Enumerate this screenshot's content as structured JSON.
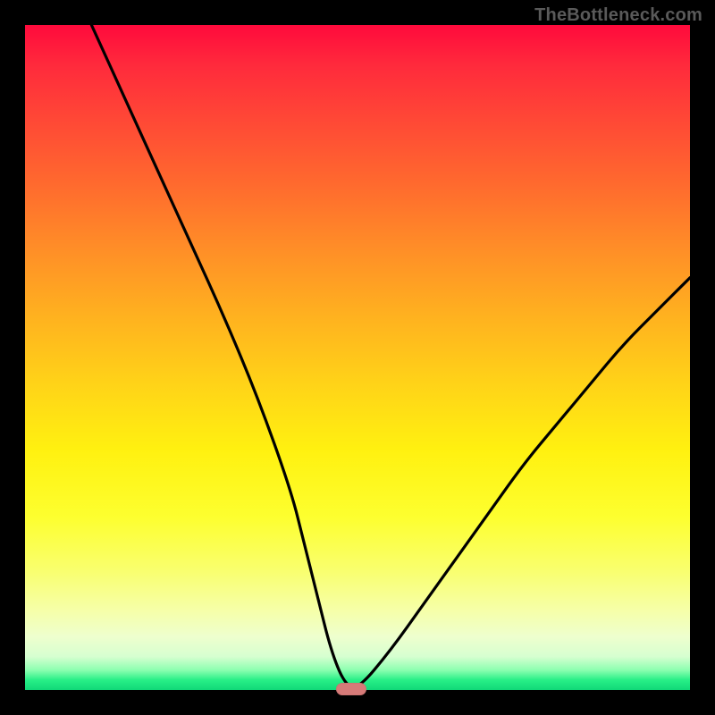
{
  "watermark": "TheBottleneck.com",
  "colors": {
    "frame": "#000000",
    "marker": "#d67a78",
    "curve": "#000000"
  },
  "chart_data": {
    "type": "line",
    "title": "",
    "xlabel": "",
    "ylabel": "",
    "xlim": [
      0,
      100
    ],
    "ylim": [
      0,
      100
    ],
    "grid": false,
    "series": [
      {
        "name": "bottleneck-curve",
        "x": [
          10,
          15,
          20,
          25,
          30,
          35,
          40,
          42,
          44,
          46,
          48,
          50,
          55,
          60,
          65,
          70,
          75,
          80,
          85,
          90,
          95,
          100
        ],
        "values": [
          100,
          89,
          78,
          67,
          56,
          44,
          30,
          22,
          14,
          6,
          1,
          0,
          6,
          13,
          20,
          27,
          34,
          40,
          46,
          52,
          57,
          62
        ]
      }
    ],
    "annotations": [
      {
        "type": "marker",
        "shape": "pill",
        "x": 49,
        "y": 0,
        "color": "#d67a78"
      }
    ]
  }
}
